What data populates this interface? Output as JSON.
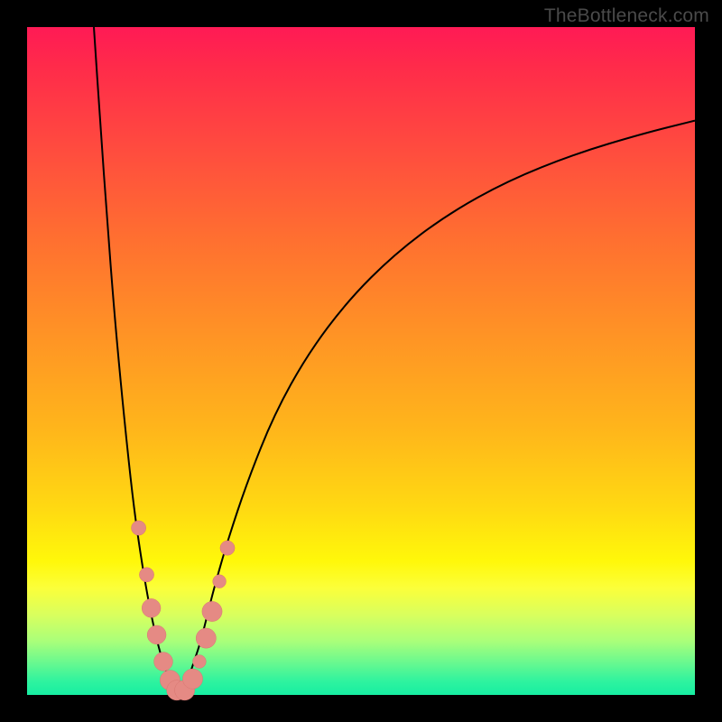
{
  "watermark": "TheBottleneck.com",
  "colors": {
    "frame": "#000000",
    "curve": "#000000",
    "marker_fill": "#e58a84",
    "marker_stroke": "#d87670",
    "gradient": [
      "#ff1a55",
      "#ff4b3f",
      "#ff9325",
      "#ffd912",
      "#fff80a",
      "#6cf98e",
      "#17eea2"
    ]
  },
  "chart_data": {
    "type": "line",
    "title": "",
    "xlabel": "",
    "ylabel": "",
    "xlim": [
      0,
      100
    ],
    "ylim": [
      0,
      100
    ],
    "series": [
      {
        "name": "left-branch",
        "x": [
          10,
          11,
          12,
          13,
          14,
          15,
          16,
          17,
          18,
          19,
          20,
          21,
          22,
          23
        ],
        "y": [
          100,
          85,
          71,
          58,
          47,
          37,
          28,
          21,
          15,
          10,
          6,
          3,
          1,
          0
        ]
      },
      {
        "name": "right-branch",
        "x": [
          23,
          24,
          25,
          26,
          27,
          28,
          30,
          33,
          37,
          42,
          48,
          55,
          63,
          72,
          82,
          92,
          100
        ],
        "y": [
          0,
          2,
          5,
          8,
          12,
          16,
          23,
          32,
          42,
          51,
          59,
          66,
          72,
          77,
          81,
          84,
          86
        ]
      }
    ],
    "markers": [
      {
        "series": "left-branch",
        "x": 16.7,
        "y": 25,
        "r": 1.1
      },
      {
        "series": "left-branch",
        "x": 17.9,
        "y": 18,
        "r": 1.1
      },
      {
        "series": "left-branch",
        "x": 18.6,
        "y": 13,
        "r": 1.4
      },
      {
        "series": "left-branch",
        "x": 19.4,
        "y": 9,
        "r": 1.4
      },
      {
        "series": "left-branch",
        "x": 20.4,
        "y": 5,
        "r": 1.4
      },
      {
        "series": "left-branch",
        "x": 21.4,
        "y": 2.2,
        "r": 1.5
      },
      {
        "series": "right-branch",
        "x": 22.4,
        "y": 0.7,
        "r": 1.5
      },
      {
        "series": "right-branch",
        "x": 23.6,
        "y": 0.7,
        "r": 1.5
      },
      {
        "series": "right-branch",
        "x": 24.8,
        "y": 2.4,
        "r": 1.5
      },
      {
        "series": "right-branch",
        "x": 25.8,
        "y": 5,
        "r": 1.0
      },
      {
        "series": "right-branch",
        "x": 26.8,
        "y": 8.5,
        "r": 1.5
      },
      {
        "series": "right-branch",
        "x": 27.7,
        "y": 12.5,
        "r": 1.5
      },
      {
        "series": "right-branch",
        "x": 28.8,
        "y": 17,
        "r": 1.0
      },
      {
        "series": "right-branch",
        "x": 30.0,
        "y": 22,
        "r": 1.1
      }
    ]
  }
}
